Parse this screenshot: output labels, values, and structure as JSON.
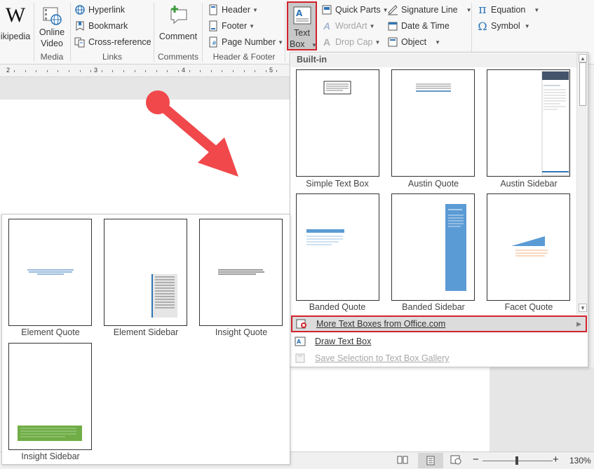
{
  "ribbon": {
    "wiki_label": "ikipedia",
    "wiki_glyph": "W",
    "online_video": [
      "Online",
      "Video"
    ],
    "media_group": "Media",
    "hyperlink": "Hyperlink",
    "bookmark": "Bookmark",
    "cross_reference": "Cross-reference",
    "links_group": "Links",
    "comment": "Comment",
    "comments_group": "Comments",
    "header": "Header",
    "footer": "Footer",
    "page_number": "Page Number",
    "header_footer_group": "Header & Footer",
    "text_box": [
      "Text",
      "Box"
    ],
    "quick_parts": "Quick Parts",
    "wordart": "WordArt",
    "drop_cap": "Drop Cap",
    "signature_line": "Signature Line",
    "date_time": "Date & Time",
    "object": "Object",
    "equation": "Equation",
    "symbol": "Symbol",
    "equation_glyph": "π",
    "symbol_glyph": "Ω"
  },
  "ruler": {
    "numbers": [
      "2",
      "3",
      "4",
      "5"
    ]
  },
  "gallery": {
    "header": "Built-in",
    "items": [
      {
        "label": "Simple Text Box"
      },
      {
        "label": "Austin Quote"
      },
      {
        "label": "Austin Sidebar"
      },
      {
        "label": "Banded Quote"
      },
      {
        "label": "Banded Sidebar"
      },
      {
        "label": "Facet Quote"
      }
    ],
    "menu": {
      "more": "More Text Boxes from Office.com",
      "draw": "Draw Text Box",
      "save": "Save Selection to Text Box Gallery"
    }
  },
  "overlay": {
    "items": [
      {
        "label": "Element Quote"
      },
      {
        "label": "Element Sidebar"
      },
      {
        "label": "Insight Quote"
      },
      {
        "label": "Insight Sidebar"
      }
    ]
  },
  "status": {
    "zoom": "130%",
    "minus": "−",
    "plus": "+"
  },
  "colors": {
    "highlight": "#d2232a",
    "arrow": "#f0484b",
    "blue": "#2e75b6",
    "green": "#70ad47"
  }
}
